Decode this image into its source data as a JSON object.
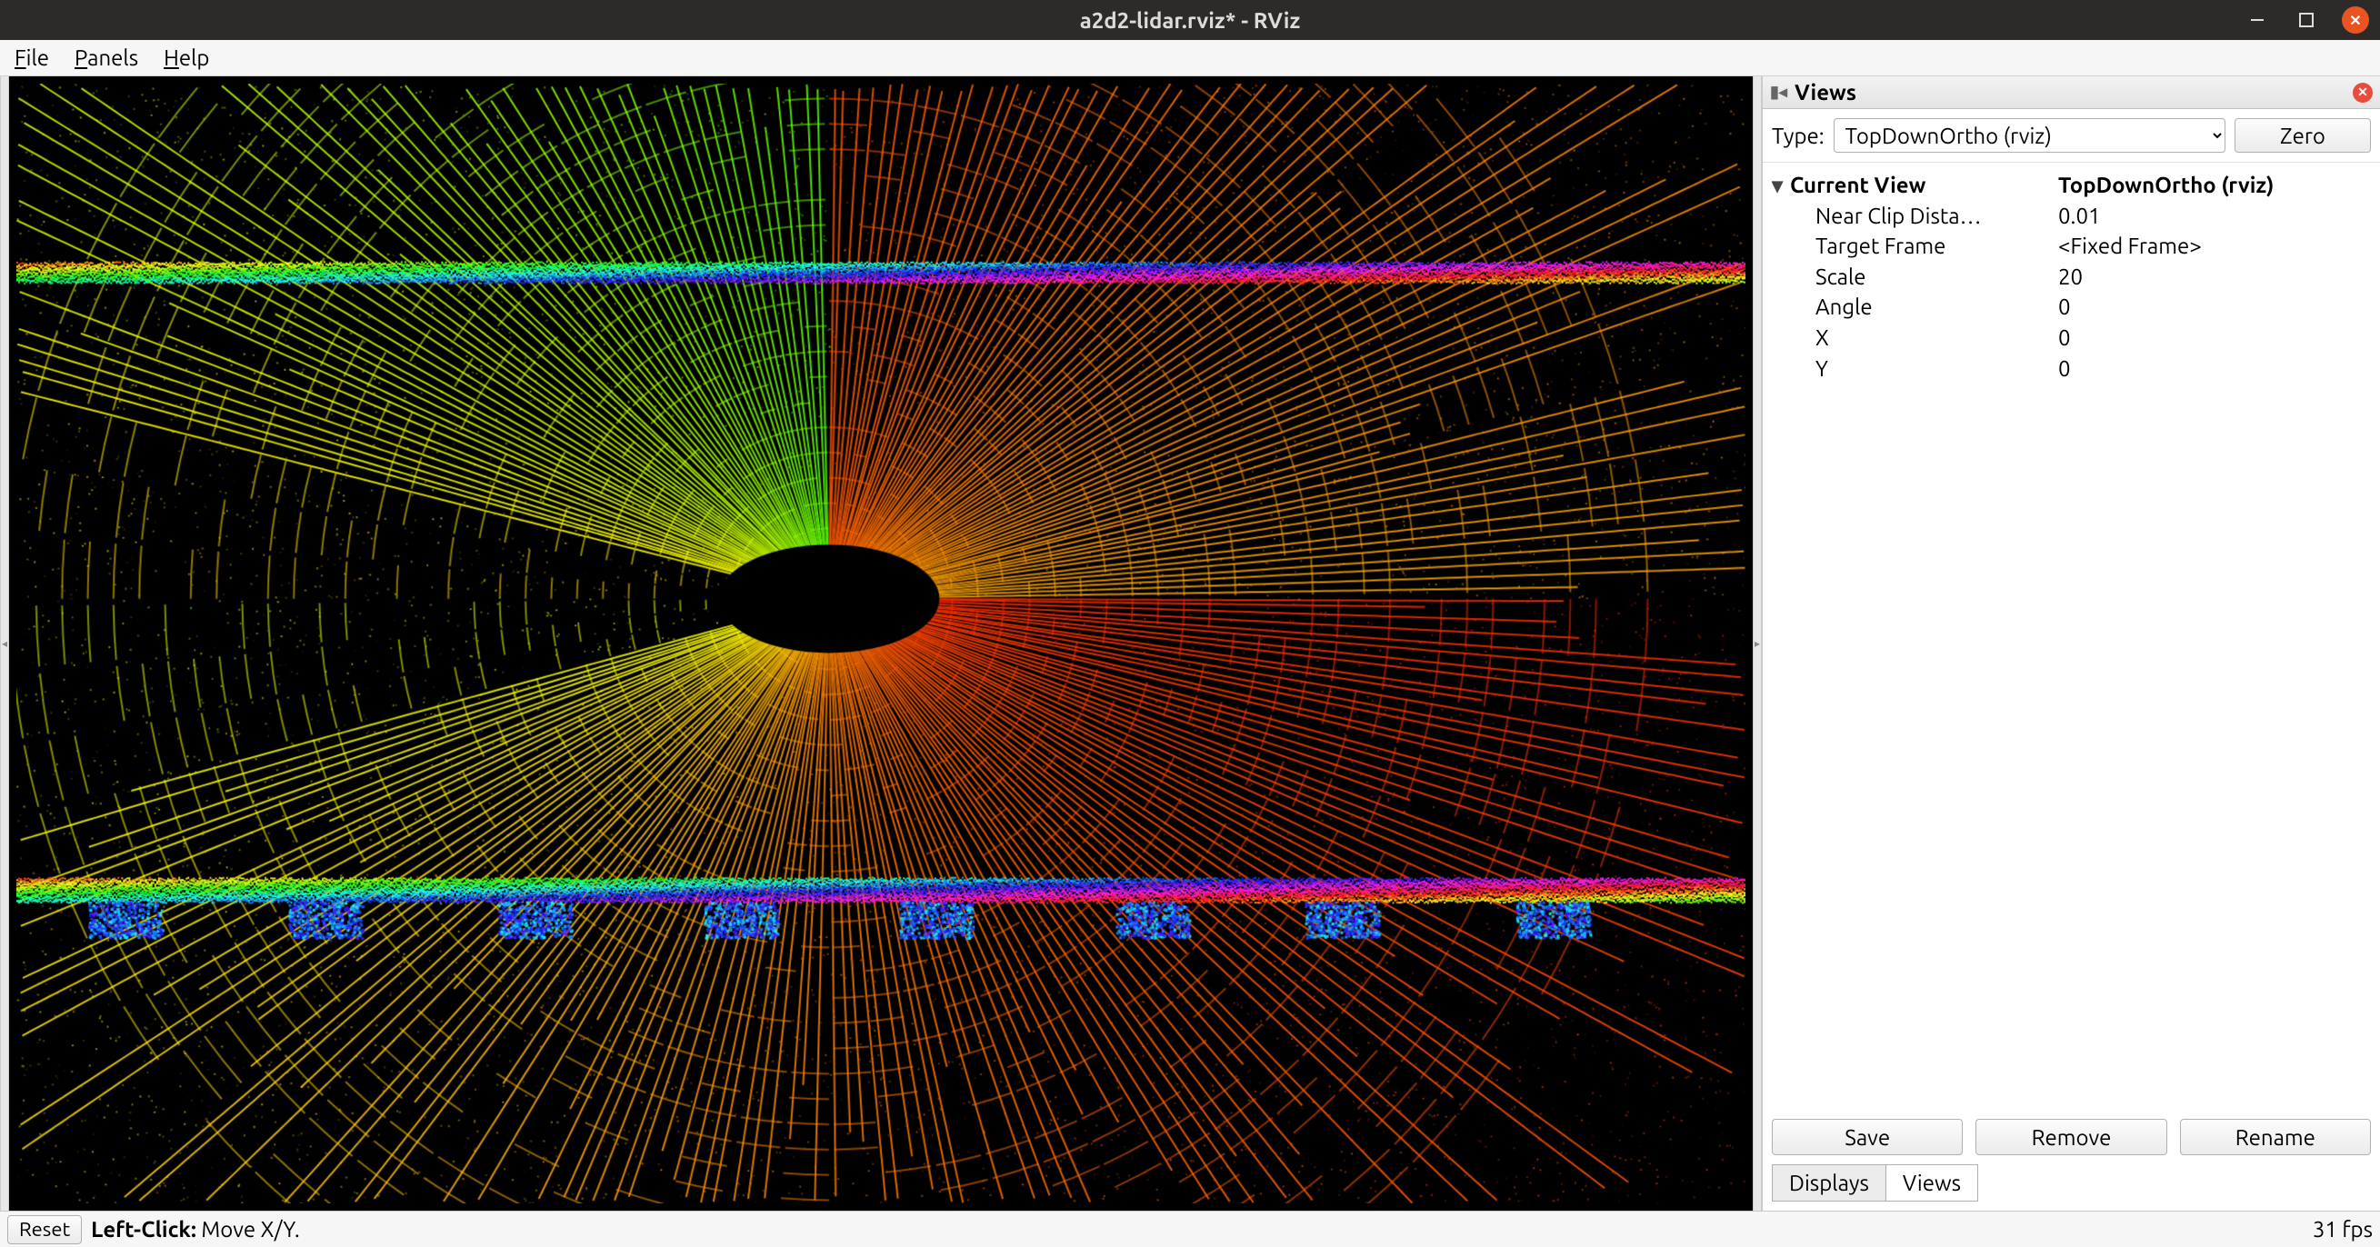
{
  "title": "a2d2-lidar.rviz* - RViz",
  "menubar": {
    "file": "File",
    "panels": "Panels",
    "help": "Help"
  },
  "views_panel": {
    "header": "Views",
    "type_label": "Type:",
    "type_selected": "TopDownOrtho (rviz)",
    "zero_label": "Zero",
    "tree": {
      "head_key": "Current View",
      "head_val": "TopDownOrtho (rviz)",
      "rows": [
        {
          "key": "Near Clip Dista…",
          "val": "0.01"
        },
        {
          "key": "Target Frame",
          "val": "<Fixed Frame>"
        },
        {
          "key": "Scale",
          "val": "20"
        },
        {
          "key": "Angle",
          "val": "0"
        },
        {
          "key": "X",
          "val": "0"
        },
        {
          "key": "Y",
          "val": "0"
        }
      ]
    },
    "buttons": {
      "save": "Save",
      "remove": "Remove",
      "rename": "Rename"
    },
    "tabs": {
      "displays": "Displays",
      "views": "Views"
    }
  },
  "statusbar": {
    "reset": "Reset",
    "hint_label": "Left-Click:",
    "hint_action": "Move X/Y.",
    "fps": "31 fps"
  }
}
